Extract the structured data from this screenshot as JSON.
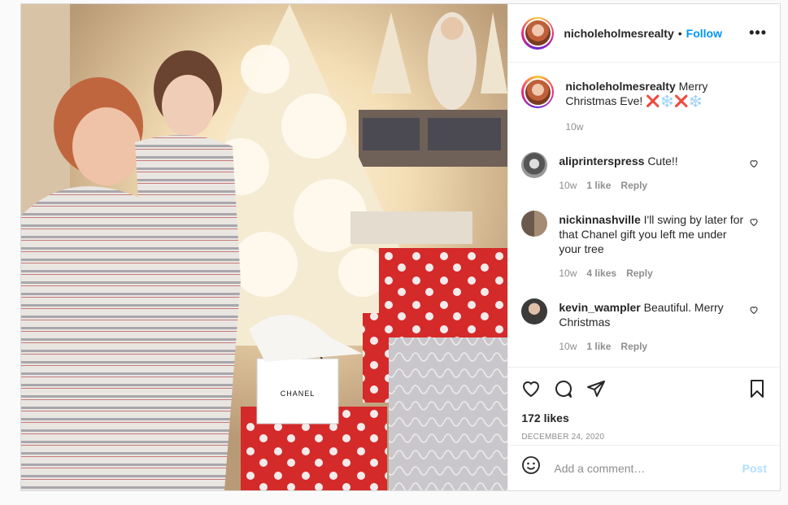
{
  "post": {
    "username": "nicholeholmesrealty",
    "follow_label": "Follow",
    "dot": "•",
    "more_label": "•••",
    "photo_alt": "CHANEL",
    "caption": {
      "username": "nicholeholmesrealty",
      "text": "Merry Christmas Eve! ❌❄️❌❄️",
      "time": "10w"
    },
    "comments": [
      {
        "username": "aliprinterspress",
        "text": "Cute!!",
        "time": "10w",
        "likes": "1 like",
        "reply": "Reply"
      },
      {
        "username": "nickinnashville",
        "text": "I'll swing by later for that Chanel gift you left me under your tree",
        "time": "10w",
        "likes": "4 likes",
        "reply": "Reply"
      },
      {
        "username": "kevin_wampler",
        "text": "Beautiful. Merry Christmas",
        "time": "10w",
        "likes": "1 like",
        "reply": "Reply"
      }
    ],
    "likes": "172 likes",
    "date": "DECEMBER 24, 2020",
    "add_comment_placeholder": "Add a comment…",
    "post_button": "Post"
  },
  "colors": {
    "accent": "#0095f6",
    "post_disabled": "#b2dffc",
    "muted": "#8e8e8e"
  },
  "icons": [
    "heart-icon",
    "comment-icon",
    "share-icon",
    "save-icon",
    "emoji-icon",
    "more-icon"
  ]
}
